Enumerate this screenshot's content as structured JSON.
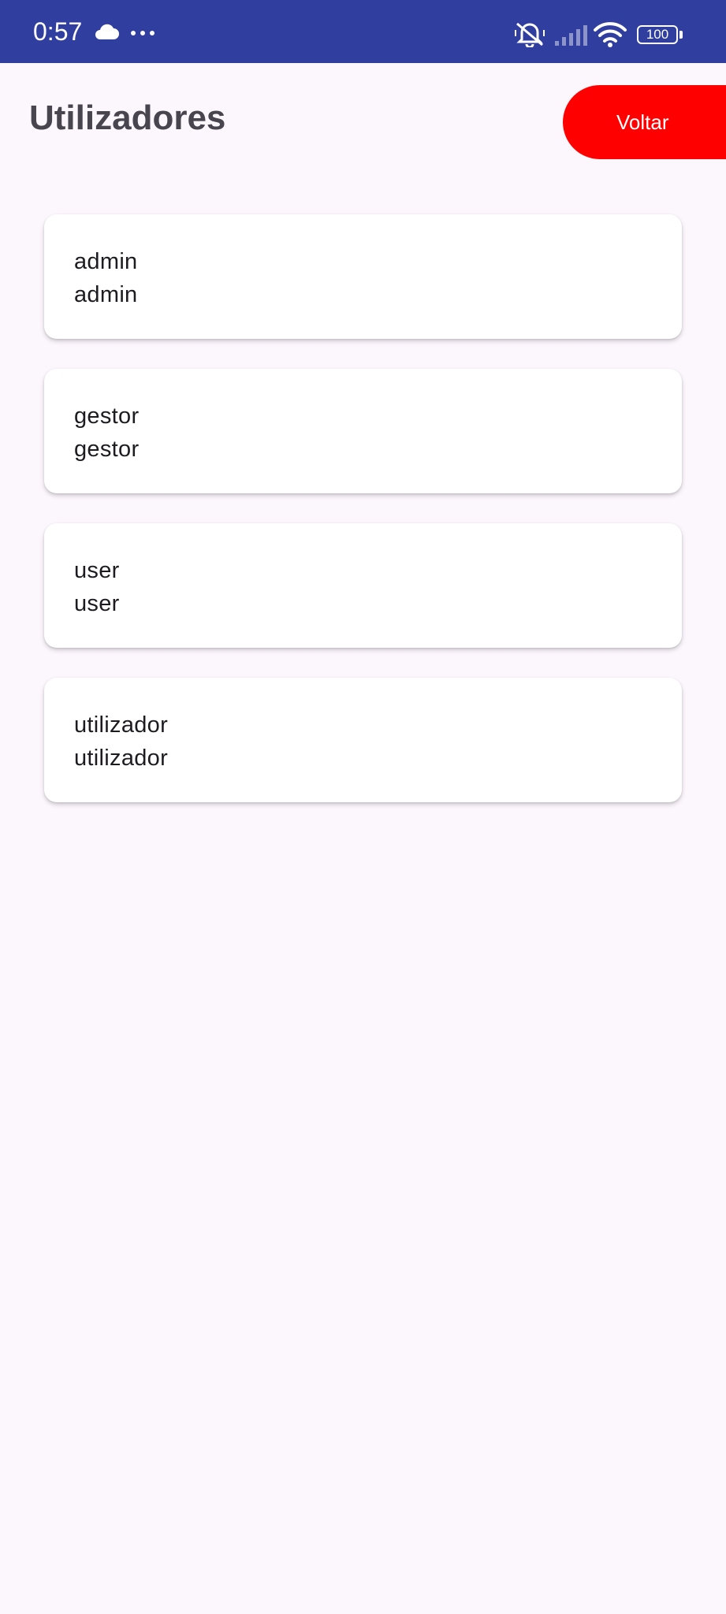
{
  "status_bar": {
    "time": "0:57",
    "battery_level": "100",
    "icons": [
      "cloud-icon",
      "more-dots-icon",
      "mute-icon",
      "signal-icon",
      "wifi-icon",
      "battery-icon"
    ],
    "background_color": "#303f9f"
  },
  "header": {
    "title": "Utilizadores",
    "back_label": "Voltar",
    "back_color": "#ff0000"
  },
  "users": [
    {
      "username": "admin",
      "role": "admin"
    },
    {
      "username": "gestor",
      "role": "gestor"
    },
    {
      "username": "user",
      "role": "user"
    },
    {
      "username": "utilizador",
      "role": "utilizador"
    }
  ],
  "colors": {
    "page_background": "#fcf6fd",
    "card_background": "#ffffff",
    "title_text": "#49454f",
    "body_text": "#1d1b20"
  }
}
